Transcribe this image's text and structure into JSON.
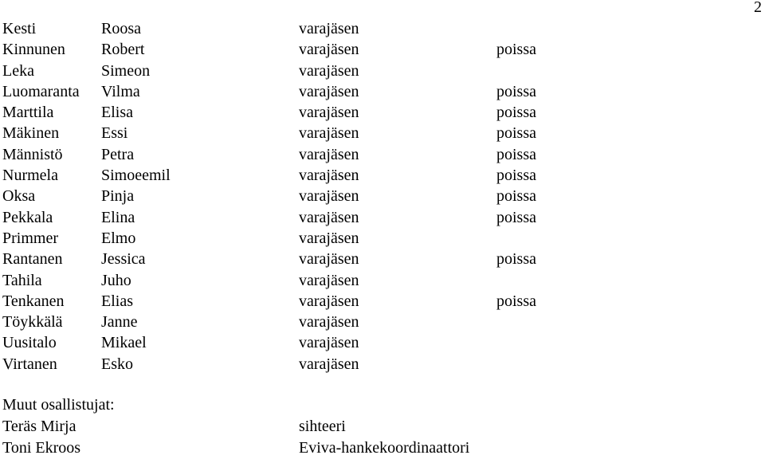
{
  "page_number": "2",
  "members": [
    {
      "last": "Kesti",
      "first": "Roosa",
      "role": "varajäsen",
      "status": ""
    },
    {
      "last": "Kinnunen",
      "first": "Robert",
      "role": "varajäsen",
      "status": "poissa"
    },
    {
      "last": "Leka",
      "first": "Simeon",
      "role": "varajäsen",
      "status": ""
    },
    {
      "last": "Luomaranta",
      "first": "Vilma",
      "role": "varajäsen",
      "status": "poissa"
    },
    {
      "last": "Marttila",
      "first": "Elisa",
      "role": "varajäsen",
      "status": "poissa"
    },
    {
      "last": "Mäkinen",
      "first": "Essi",
      "role": "varajäsen",
      "status": "poissa"
    },
    {
      "last": "Männistö",
      "first": "Petra",
      "role": "varajäsen",
      "status": "poissa"
    },
    {
      "last": "Nurmela",
      "first": "Simoeemil",
      "role": "varajäsen",
      "status": "poissa"
    },
    {
      "last": "Oksa",
      "first": "Pinja",
      "role": "varajäsen",
      "status": "poissa"
    },
    {
      "last": "Pekkala",
      "first": "Elina",
      "role": "varajäsen",
      "status": "poissa"
    },
    {
      "last": "Primmer",
      "first": "Elmo",
      "role": "varajäsen",
      "status": ""
    },
    {
      "last": "Rantanen",
      "first": "Jessica",
      "role": "varajäsen",
      "status": "poissa"
    },
    {
      "last": "Tahila",
      "first": "Juho",
      "role": "varajäsen",
      "status": ""
    },
    {
      "last": "Tenkanen",
      "first": "Elias",
      "role": "varajäsen",
      "status": "poissa"
    },
    {
      "last": "Töykkälä",
      "first": "Janne",
      "role": "varajäsen",
      "status": ""
    },
    {
      "last": "Uusitalo",
      "first": "Mikael",
      "role": "varajäsen",
      "status": ""
    },
    {
      "last": "Virtanen",
      "first": "Esko",
      "role": "varajäsen",
      "status": ""
    }
  ],
  "others": {
    "heading": "Muut osallistujat:",
    "people": [
      {
        "name": "Teräs Mirja",
        "role": "sihteeri"
      },
      {
        "name": "Toni Ekroos",
        "role": "Eviva-hankekoordinaattori"
      }
    ]
  }
}
